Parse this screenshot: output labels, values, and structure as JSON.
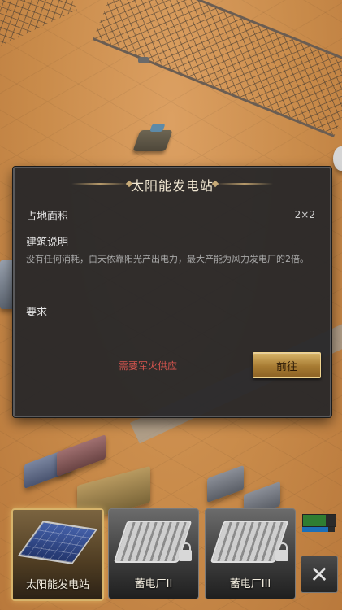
{
  "dialog": {
    "title": "太阳能发电站",
    "footprint_label": "占地面积",
    "footprint_value": "2×2",
    "description_label": "建筑说明",
    "description_text": "没有任何消耗，白天依靠阳光产出电力，最大产能为风力发电厂的2倍。",
    "requirements_label": "要求",
    "warning_text": "需要军火供应",
    "go_button_label": "前往"
  },
  "building_bar": {
    "items": [
      {
        "label": "太阳能发电站",
        "selected": true,
        "locked": false,
        "icon": "solar-panel-icon"
      },
      {
        "label": "蓄电厂II",
        "selected": false,
        "locked": true,
        "icon": "battery-plant-icon"
      },
      {
        "label": "蓄电厂III",
        "selected": false,
        "locked": true,
        "icon": "battery-plant-icon"
      }
    ],
    "close_symbol": "✕"
  },
  "colors": {
    "warning": "#d9554f",
    "button_gold": "#c49a4c",
    "dialog_bg": "#262628"
  }
}
